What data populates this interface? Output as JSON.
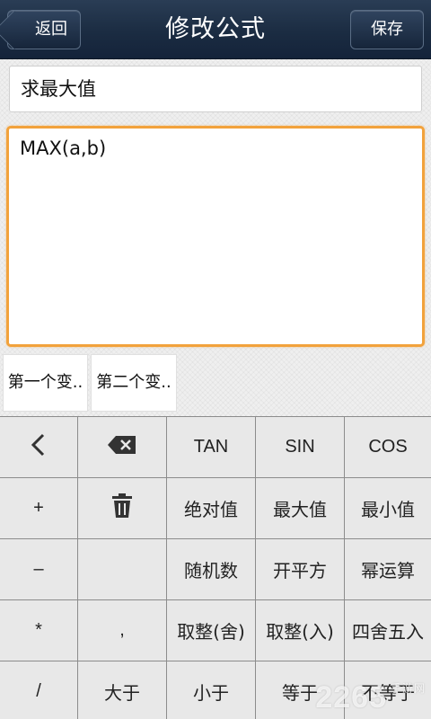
{
  "header": {
    "back_label": "返回",
    "title": "修改公式",
    "save_label": "保存"
  },
  "formula": {
    "name": "求最大值",
    "expression": "MAX(a,b)"
  },
  "variables": [
    "第一个变..",
    "第二个变.."
  ],
  "keypad": {
    "rows": [
      [
        "back-icon",
        "backspace-icon",
        "TAN",
        "SIN",
        "COS"
      ],
      [
        "+",
        "trash-icon",
        "绝对值",
        "最大值",
        "最小值"
      ],
      [
        "–",
        "",
        "随机数",
        "开平方",
        "幂运算"
      ],
      [
        "*",
        ",",
        "取整(舍)",
        "取整(入)",
        "四舍五入"
      ],
      [
        "/",
        "大于",
        "小于",
        "等于",
        "不等于"
      ]
    ]
  },
  "watermark": {
    "text": "2265",
    "sub": "手游网"
  }
}
